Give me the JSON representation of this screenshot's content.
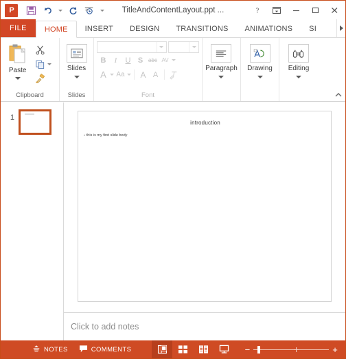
{
  "window": {
    "title": "TitleAndContentLayout.ppt ...",
    "app_icon": "powerpoint-logo-icon",
    "quick_access": [
      {
        "name": "save-icon",
        "label": "Save"
      },
      {
        "name": "undo-icon",
        "label": "Undo"
      },
      {
        "name": "redo-icon",
        "label": "Redo"
      },
      {
        "name": "start-slideshow-icon",
        "label": "Start From Beginning"
      },
      {
        "name": "customize-qat-icon",
        "label": "Customize Quick Access Toolbar"
      }
    ],
    "controls": [
      {
        "name": "help-button",
        "glyph": "?"
      },
      {
        "name": "ribbon-display-options-button",
        "glyph": "ribbon-options-icon"
      },
      {
        "name": "minimize-button",
        "glyph": "minimize-icon"
      },
      {
        "name": "maximize-button",
        "glyph": "maximize-icon"
      },
      {
        "name": "close-button",
        "glyph": "close-icon"
      }
    ]
  },
  "ribbon": {
    "file_tab": "FILE",
    "tabs": [
      {
        "label": "HOME",
        "active": true
      },
      {
        "label": "INSERT",
        "active": false
      },
      {
        "label": "DESIGN",
        "active": false
      },
      {
        "label": "TRANSITIONS",
        "active": false
      },
      {
        "label": "ANIMATIONS",
        "active": false
      },
      {
        "label": "SI",
        "active": false
      }
    ],
    "groups": {
      "clipboard": {
        "label": "Clipboard",
        "paste_label": "Paste",
        "cut_label": "Cut",
        "copy_label": "Copy",
        "format_painter_label": "Format Painter"
      },
      "slides": {
        "label": "Slides",
        "button_label": "Slides"
      },
      "font": {
        "label": "Font",
        "font_name_value": "",
        "font_size_value": "",
        "bold": "B",
        "italic": "I",
        "underline": "U",
        "shadow": "S",
        "strikethrough": "abc",
        "character_spacing": "AV",
        "font_color": "A",
        "change_case": "Aa",
        "increase_font": "A",
        "decrease_font": "A",
        "clear_formatting": "clear-formatting-icon",
        "disabled": true
      },
      "paragraph": {
        "label": "Paragraph"
      },
      "drawing": {
        "label": "Drawing"
      },
      "editing": {
        "label": "Editing"
      }
    },
    "collapse_label": "Collapse the Ribbon"
  },
  "thumbnails": [
    {
      "number": "1",
      "selected": true
    }
  ],
  "slide": {
    "title": "introduction",
    "bullet_glyph": "▪",
    "body": "this is  my first slide body"
  },
  "notes": {
    "placeholder": "Click to add notes"
  },
  "statusbar": {
    "notes_label": "NOTES",
    "comments_label": "COMMENTS",
    "views": [
      {
        "name": "normal-view-button",
        "label": "Normal",
        "active": true
      },
      {
        "name": "slide-sorter-view-button",
        "label": "Slide Sorter",
        "active": false
      },
      {
        "name": "reading-view-button",
        "label": "Reading View",
        "active": false
      },
      {
        "name": "slide-show-button",
        "label": "Slide Show",
        "active": false
      }
    ],
    "zoom_out": "−",
    "zoom_in": "+"
  },
  "colors": {
    "accent": "#d24726",
    "statusbar": "#cf4b24",
    "selection": "#c0501e"
  }
}
